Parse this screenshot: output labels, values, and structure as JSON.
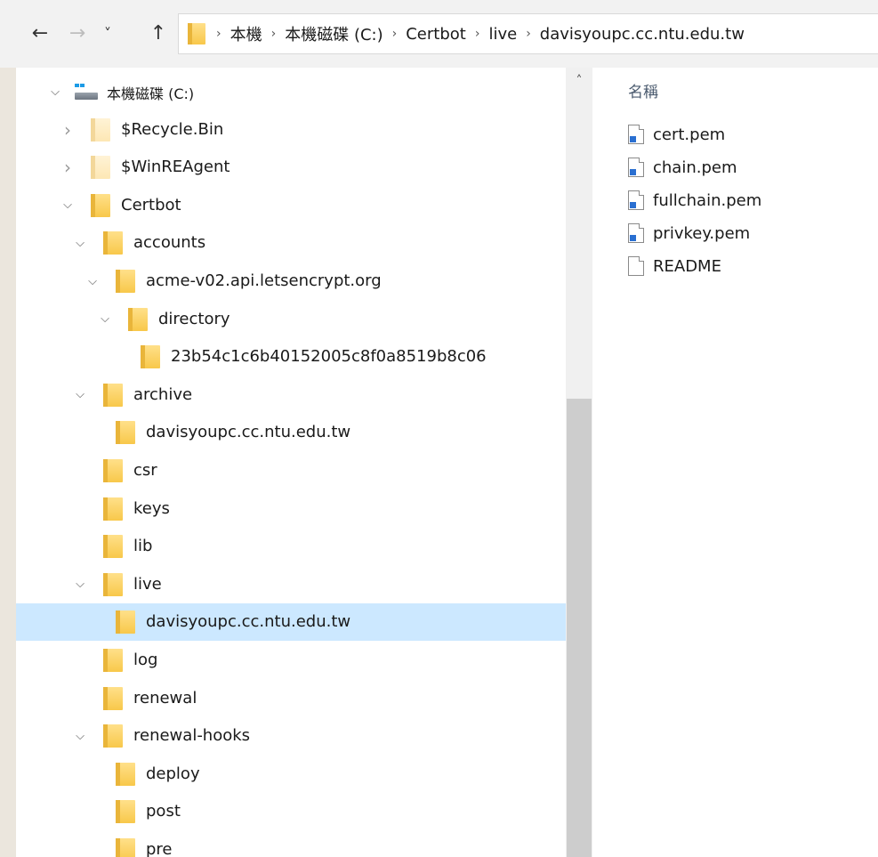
{
  "nav": {
    "back_glyph": "←",
    "forward_glyph": "→",
    "recent_glyph": "˅",
    "up_glyph": "↑"
  },
  "address": {
    "crumbs": [
      "本機",
      "本機磁碟 (C:)",
      "Certbot",
      "live",
      "davisyoupc.cc.ntu.edu.tw"
    ]
  },
  "tree": {
    "drive_label": "本機磁碟 (C:)",
    "items": [
      {
        "label": "$Recycle.Bin",
        "level": 1,
        "chevron": "collapsed",
        "pale": true
      },
      {
        "label": "$WinREAgent",
        "level": 1,
        "chevron": "collapsed",
        "pale": true
      },
      {
        "label": "Certbot",
        "level": 1,
        "chevron": "expanded"
      },
      {
        "label": "accounts",
        "level": 2,
        "chevron": "expanded"
      },
      {
        "label": "acme-v02.api.letsencrypt.org",
        "level": 3,
        "chevron": "expanded"
      },
      {
        "label": "directory",
        "level": 4,
        "chevron": "expanded"
      },
      {
        "label": "23b54c1c6b40152005c8f0a8519b8c06",
        "level": 5,
        "chevron": "none"
      },
      {
        "label": "archive",
        "level": 2,
        "chevron": "expanded"
      },
      {
        "label": "davisyoupc.cc.ntu.edu.tw",
        "level": 3,
        "chevron": "none"
      },
      {
        "label": "csr",
        "level": 2,
        "chevron": "none"
      },
      {
        "label": "keys",
        "level": 2,
        "chevron": "none"
      },
      {
        "label": "lib",
        "level": 2,
        "chevron": "none"
      },
      {
        "label": "live",
        "level": 2,
        "chevron": "expanded"
      },
      {
        "label": "davisyoupc.cc.ntu.edu.tw",
        "level": 3,
        "chevron": "none",
        "selected": true
      },
      {
        "label": "log",
        "level": 2,
        "chevron": "none"
      },
      {
        "label": "renewal",
        "level": 2,
        "chevron": "none"
      },
      {
        "label": "renewal-hooks",
        "level": 2,
        "chevron": "expanded"
      },
      {
        "label": "deploy",
        "level": 3,
        "chevron": "none"
      },
      {
        "label": "post",
        "level": 3,
        "chevron": "none"
      },
      {
        "label": "pre",
        "level": 3,
        "chevron": "none"
      }
    ]
  },
  "content": {
    "column_header": "名稱",
    "files": [
      {
        "name": "cert.pem",
        "shortcut": true
      },
      {
        "name": "chain.pem",
        "shortcut": true
      },
      {
        "name": "fullchain.pem",
        "shortcut": true
      },
      {
        "name": "privkey.pem",
        "shortcut": true
      },
      {
        "name": "README",
        "shortcut": false
      }
    ]
  },
  "colors": {
    "selection": "#cce8ff",
    "folder": "#f8c84a"
  }
}
